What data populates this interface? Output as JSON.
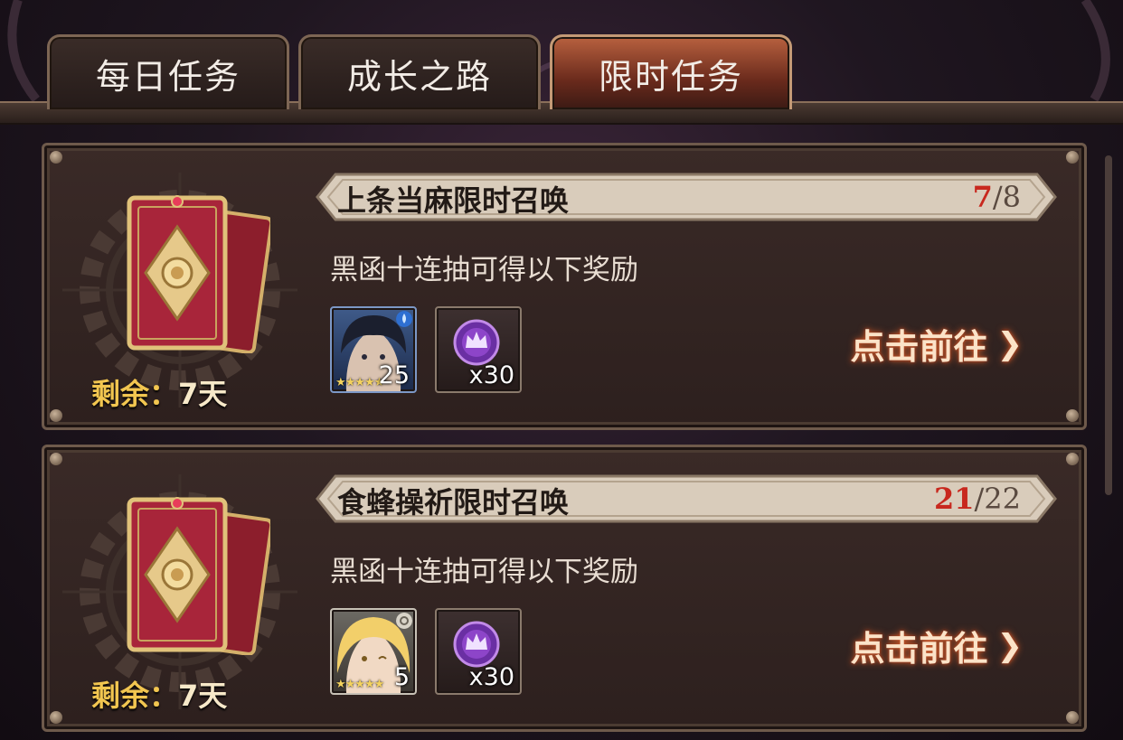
{
  "tabs": [
    {
      "label": "每日任务",
      "active": false
    },
    {
      "label": "成长之路",
      "active": false
    },
    {
      "label": "限时任务",
      "active": true
    }
  ],
  "tasks": [
    {
      "title": "上条当麻限时召唤",
      "progress_current": "7",
      "progress_sep": "/",
      "progress_total": "8",
      "description": "黑函十连抽可得以下奖励",
      "remaining_label": "剩余：",
      "remaining_value": "7天",
      "hero_level": "25",
      "hero_element": "water-drop-icon",
      "hero_stars": "★★★★★",
      "item_qty": "x30",
      "goto_label": "点击前往",
      "goto_icon": "chevron-right-icon"
    },
    {
      "title": "食蜂操祈限时召唤",
      "progress_current": "21",
      "progress_sep": "/",
      "progress_total": "22",
      "description": "黑函十连抽可得以下奖励",
      "remaining_label": "剩余：",
      "remaining_value": "7天",
      "hero_level": "5",
      "hero_element": "gear-element-icon",
      "hero_stars": "★★★★★",
      "item_qty": "x30",
      "goto_label": "点击前往",
      "goto_icon": "chevron-right-icon"
    }
  ],
  "colors": {
    "progress_current": "#c8281e",
    "active_tab": "#b8613f",
    "goto_glow": "#e0642c",
    "remaining_label": "#f2c650"
  }
}
